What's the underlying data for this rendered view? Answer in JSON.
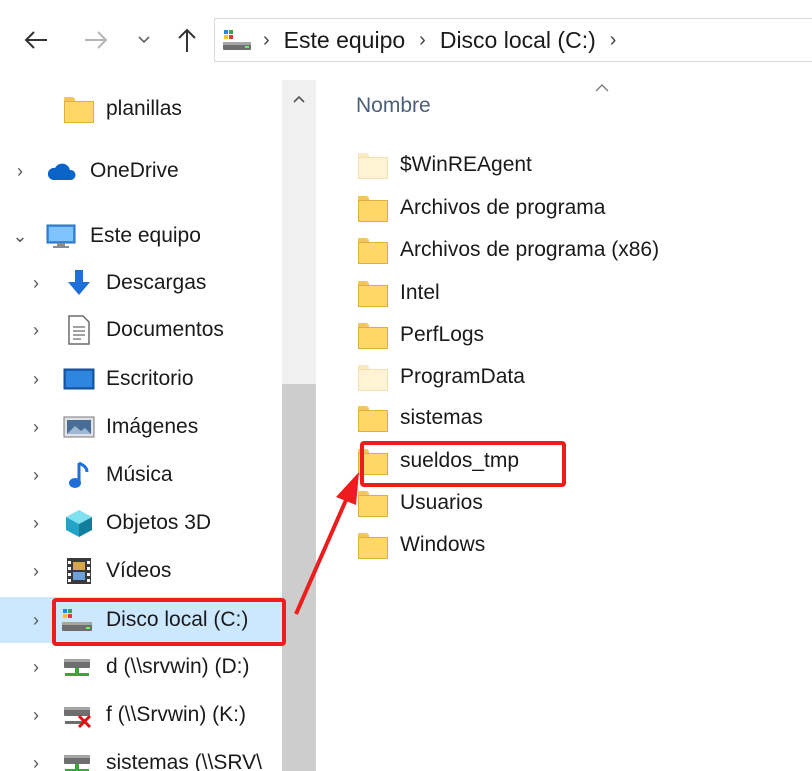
{
  "address_bar": {
    "crumbs": [
      "Este equipo",
      "Disco local (C:)"
    ]
  },
  "nav_pane": {
    "items": [
      {
        "label": "planillas",
        "icon": "folder-icon"
      },
      {
        "label": "OneDrive",
        "icon": "cloud-icon"
      },
      {
        "label": "Este equipo",
        "icon": "computer-icon"
      },
      {
        "label": "Descargas",
        "icon": "download-arrow-icon"
      },
      {
        "label": "Documentos",
        "icon": "document-icon"
      },
      {
        "label": "Escritorio",
        "icon": "desktop-icon"
      },
      {
        "label": "Imágenes",
        "icon": "pictures-icon"
      },
      {
        "label": "Música",
        "icon": "music-note-icon"
      },
      {
        "label": "Objetos 3D",
        "icon": "cube-3d-icon"
      },
      {
        "label": "Vídeos",
        "icon": "film-icon"
      },
      {
        "label": "Disco local (C:)",
        "icon": "local-drive-icon"
      },
      {
        "label": "d (\\\\srvwin) (D:)",
        "icon": "network-drive-icon"
      },
      {
        "label": "f (\\\\Srvwin) (K:)",
        "icon": "disconnected-drive-icon"
      },
      {
        "label": "sistemas (\\\\SRV\\",
        "icon": "network-drive-icon"
      }
    ]
  },
  "content": {
    "column_header": "Nombre",
    "files": [
      {
        "name": "$WinREAgent",
        "hidden": true
      },
      {
        "name": "Archivos de programa",
        "hidden": false
      },
      {
        "name": "Archivos de programa (x86)",
        "hidden": false
      },
      {
        "name": "Intel",
        "hidden": false
      },
      {
        "name": "PerfLogs",
        "hidden": false
      },
      {
        "name": "ProgramData",
        "hidden": true
      },
      {
        "name": "sistemas",
        "hidden": false
      },
      {
        "name": "sueldos_tmp",
        "hidden": false
      },
      {
        "name": "Usuarios",
        "hidden": false
      },
      {
        "name": "Windows",
        "hidden": false
      }
    ]
  },
  "colors": {
    "selection": "#cce8ff",
    "annotation": "#ee1c1c",
    "folder": "#ffd766"
  }
}
